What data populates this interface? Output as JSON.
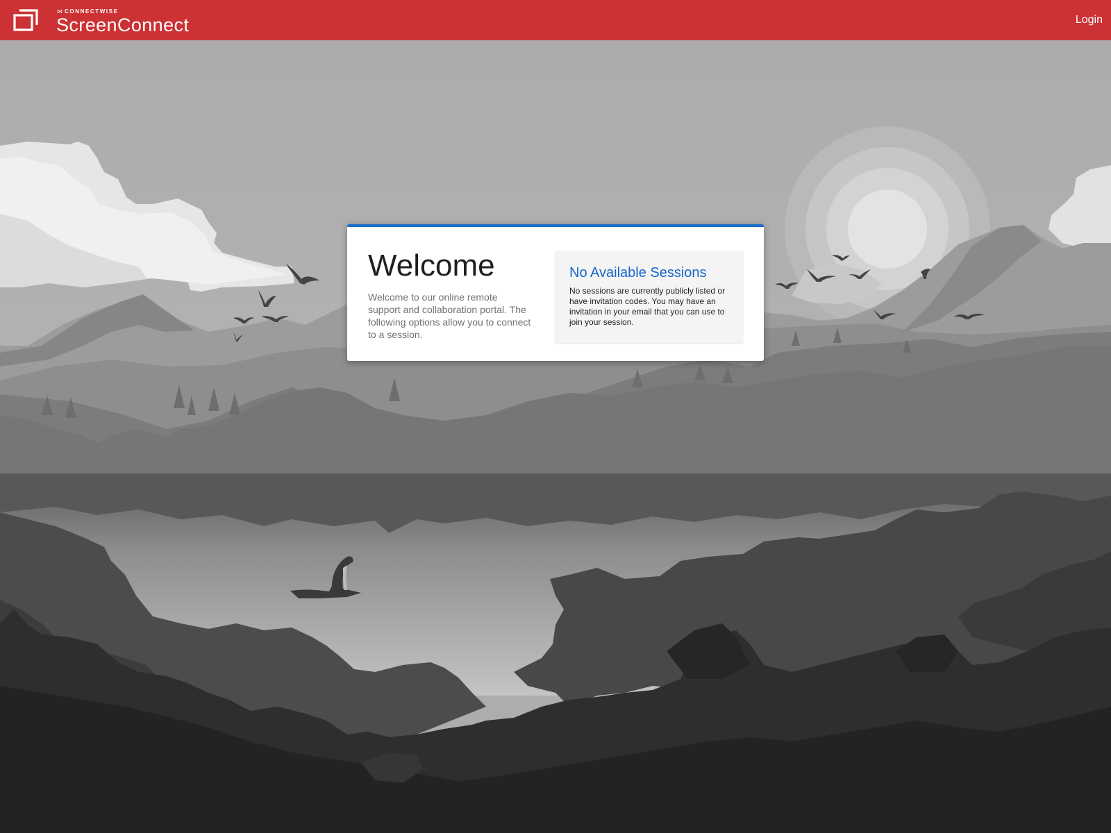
{
  "header": {
    "brand_small": "CONNECTWISE",
    "brand_name": "ScreenConnect",
    "login_label": "Login",
    "color": "#cc3133"
  },
  "welcome": {
    "title": "Welcome",
    "text": "Welcome to our online remote support and collaboration portal. The following options allow you to connect to a session."
  },
  "sessions": {
    "title": "No Available Sessions",
    "text": "No sessions are currently publicly listed or have invitation codes. You may have an invitation in your email that you can use to join your session."
  },
  "colors": {
    "accent": "#1d6fc9",
    "link": "#1466c8"
  },
  "icons": {
    "logo": "screenconnect-logo-icon",
    "brand_mark": "connectwise-mark-icon"
  }
}
